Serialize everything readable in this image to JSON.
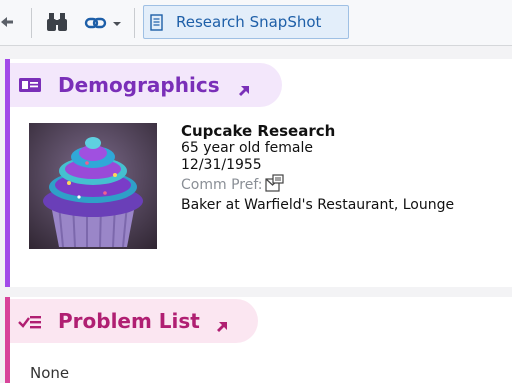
{
  "toolbar": {
    "back_icon": "back-arrow-icon",
    "search_icon": "binoculars-icon",
    "link_icon": "chain-link-icon",
    "snapshot_label": "Research SnapShot",
    "snapshot_icon": "document-icon"
  },
  "demographics": {
    "title": "Demographics",
    "accent_color": "#a24be8",
    "name": "Cupcake Research",
    "age_sex": "65 year old female",
    "dob": "12/31/1955",
    "comm_pref_label": "Comm Pref:",
    "occupation": "Baker at Warfield's Restaurant, Lounge"
  },
  "problem_list": {
    "title": "Problem List",
    "accent_color": "#d8459a",
    "value": "None"
  }
}
